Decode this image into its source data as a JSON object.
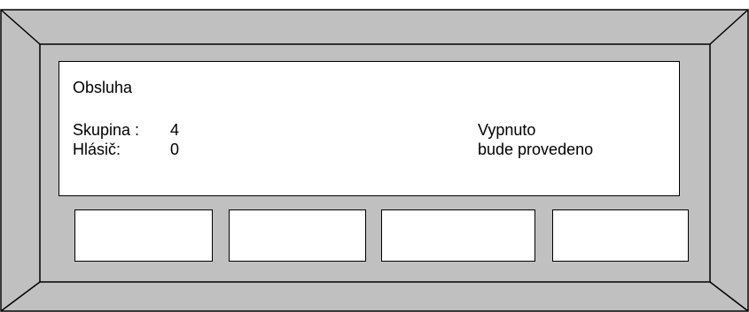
{
  "colors": {
    "bezel": "#c0c0c0",
    "display_background": "#ffffff",
    "outline": "#000000"
  },
  "display": {
    "title": "Obsluha",
    "group_label": "Skupina :",
    "group_value": "4",
    "detector_label": "Hlásič:",
    "detector_value": "0",
    "status_line_1": "Vypnuto",
    "status_line_2": "bude provedeno"
  },
  "softkeys": [
    {
      "label": ""
    },
    {
      "label": ""
    },
    {
      "label": ""
    },
    {
      "label": ""
    }
  ]
}
